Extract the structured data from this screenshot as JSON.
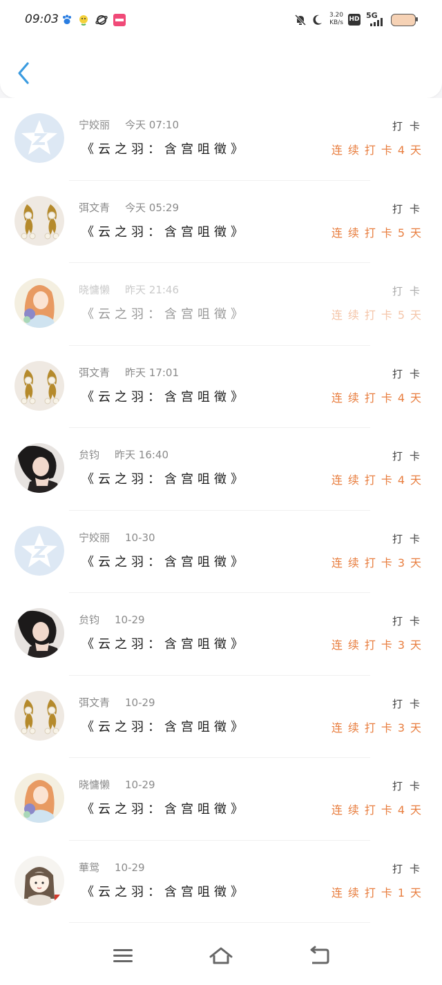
{
  "status_bar": {
    "time": "09:03",
    "net_speed_value": "3.20",
    "net_speed_unit": "KB/s",
    "hd": "HD",
    "network": "5G"
  },
  "header": {
    "back_icon": "chevron-left-icon"
  },
  "colors": {
    "accent_blue": "#3a9be0",
    "streak_orange": "#e87d3e"
  },
  "entries": [
    {
      "name": "宁姣丽",
      "time": "今天 07:10",
      "message": "《云之羽：含宫咀徵》",
      "label": "打卡",
      "streak": "连续打卡4天",
      "avatar": "qzone-star"
    },
    {
      "name": "弭文青",
      "time": "今天 05:29",
      "message": "《云之羽：含宫咀徵》",
      "label": "打卡",
      "streak": "连续打卡5天",
      "avatar": "gold-earrings"
    },
    {
      "name": "晓慵懒",
      "time": "昨天 21:46",
      "message": "《云之羽：含宫咀徵》",
      "label": "打卡",
      "streak": "连续打卡5天",
      "avatar": "orange-hair-girl"
    },
    {
      "name": "弭文青",
      "time": "昨天 17:01",
      "message": "《云之羽：含宫咀徵》",
      "label": "打卡",
      "streak": "连续打卡4天",
      "avatar": "gold-earrings"
    },
    {
      "name": "贠钧",
      "time": "昨天 16:40",
      "message": "《云之羽：含宫咀徵》",
      "label": "打卡",
      "streak": "连续打卡4天",
      "avatar": "dark-hair-woman"
    },
    {
      "name": "宁姣丽",
      "time": "10-30",
      "message": "《云之羽：含宫咀徵》",
      "label": "打卡",
      "streak": "连续打卡3天",
      "avatar": "qzone-star"
    },
    {
      "name": "贠钧",
      "time": "10-29",
      "message": "《云之羽：含宫咀徵》",
      "label": "打卡",
      "streak": "连续打卡3天",
      "avatar": "dark-hair-woman"
    },
    {
      "name": "弭文青",
      "time": "10-29",
      "message": "《云之羽：含宫咀徵》",
      "label": "打卡",
      "streak": "连续打卡3天",
      "avatar": "gold-earrings"
    },
    {
      "name": "晓慵懒",
      "time": "10-29",
      "message": "《云之羽：含宫咀徵》",
      "label": "打卡",
      "streak": "连续打卡4天",
      "avatar": "orange-hair-girl"
    },
    {
      "name": "華鸳",
      "time": "10-29",
      "message": "《云之羽：含宫咀徵》",
      "label": "打卡",
      "streak": "连续打卡1天",
      "avatar": "cartoon-girl"
    }
  ],
  "navbar": {
    "menu_icon": "menu-icon",
    "home_icon": "home-icon",
    "back_icon": "back-icon"
  }
}
